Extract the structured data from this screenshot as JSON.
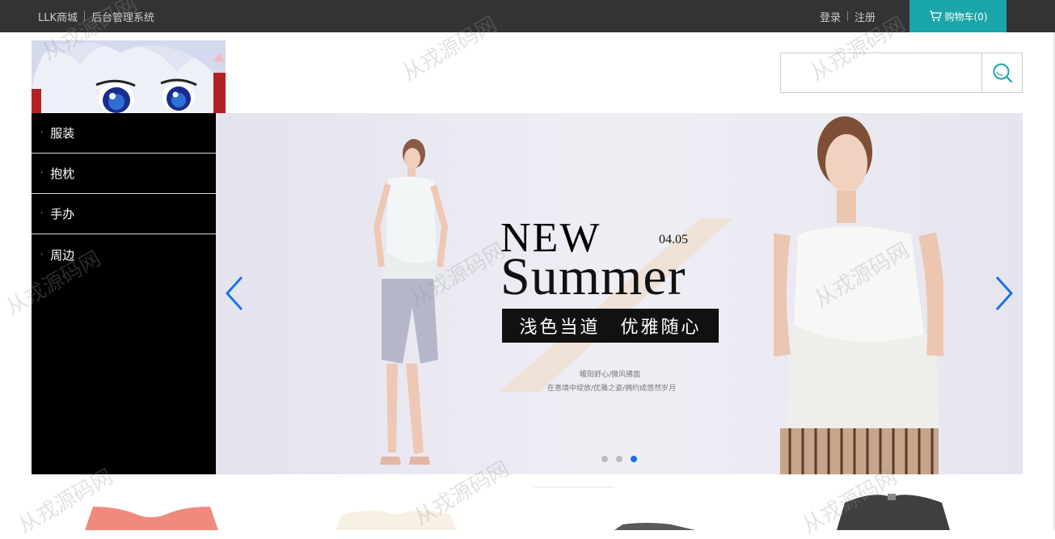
{
  "topbar": {
    "shop_name": "LLK商城",
    "admin_link": "后台管理系统",
    "login": "登录",
    "register": "注册",
    "cart": "购物车(0)"
  },
  "search": {
    "placeholder": ""
  },
  "categories": [
    "服装",
    "抱枕",
    "手办",
    "周边"
  ],
  "banner": {
    "new": "NEW",
    "date": "04.05",
    "summer": "Summer",
    "tagline": "浅色当道　优雅随心",
    "sub1": "暖阳舒心/微风拂面",
    "sub2": "在意境中绽放/优雅之姿/拥约成悠然岁月",
    "slide_count": 3,
    "active_slide": 3
  },
  "watermark": "从戎源码网",
  "colors": {
    "topbar": "#333333",
    "cart": "#1aa5a9",
    "nav": "#000000",
    "arrow": "#1a73e8"
  }
}
